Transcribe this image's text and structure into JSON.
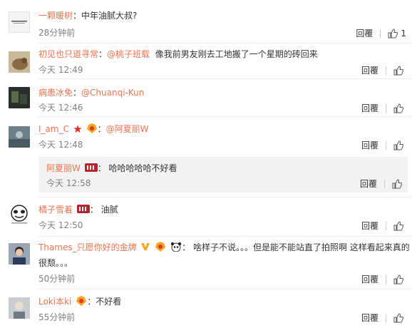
{
  "labels": {
    "reply": "回覆",
    "colon": "：",
    "colon_space": "： "
  },
  "comments": [
    {
      "username": "一颗暖树",
      "text": "中年油腻大叔?",
      "time": "28分钟前",
      "likes": "1"
    },
    {
      "username": "初见也只道寻常",
      "mention": "@桃子班载",
      "text": "像我前男友刚去工地搬了一个星期的砖回来",
      "time": "今天 12:49",
      "likes": ""
    },
    {
      "username": "病患冰免",
      "mention": "@Chuanqi-Kun",
      "text": "",
      "time": "今天 12:46",
      "likes": ""
    },
    {
      "username": "I_am_C",
      "mention": "@阿夏丽W",
      "text": "",
      "time": "今天 12:48",
      "likes": "",
      "reply": {
        "username": "阿夏丽W",
        "text": "哈哈哈哈哈不好看",
        "time": "今天 12:58",
        "likes": ""
      }
    },
    {
      "username": "橘子雪着",
      "text": "油腻",
      "time": "今天 12:50",
      "likes": ""
    },
    {
      "username": "Thames_只愿你好的金牌",
      "text": "啥样子不说。。。但是能不能站直了拍照啊 这样看起来真的",
      "text_line2": "很颓。。。",
      "time": "50分钟前",
      "likes": ""
    },
    {
      "username": "Loki本ki",
      "text": "不好看",
      "time": "55分钟前",
      "likes": ""
    }
  ],
  "colors": {
    "username": "#eb7350",
    "meta": "#808080",
    "reply_bg": "#f2f2f2"
  }
}
